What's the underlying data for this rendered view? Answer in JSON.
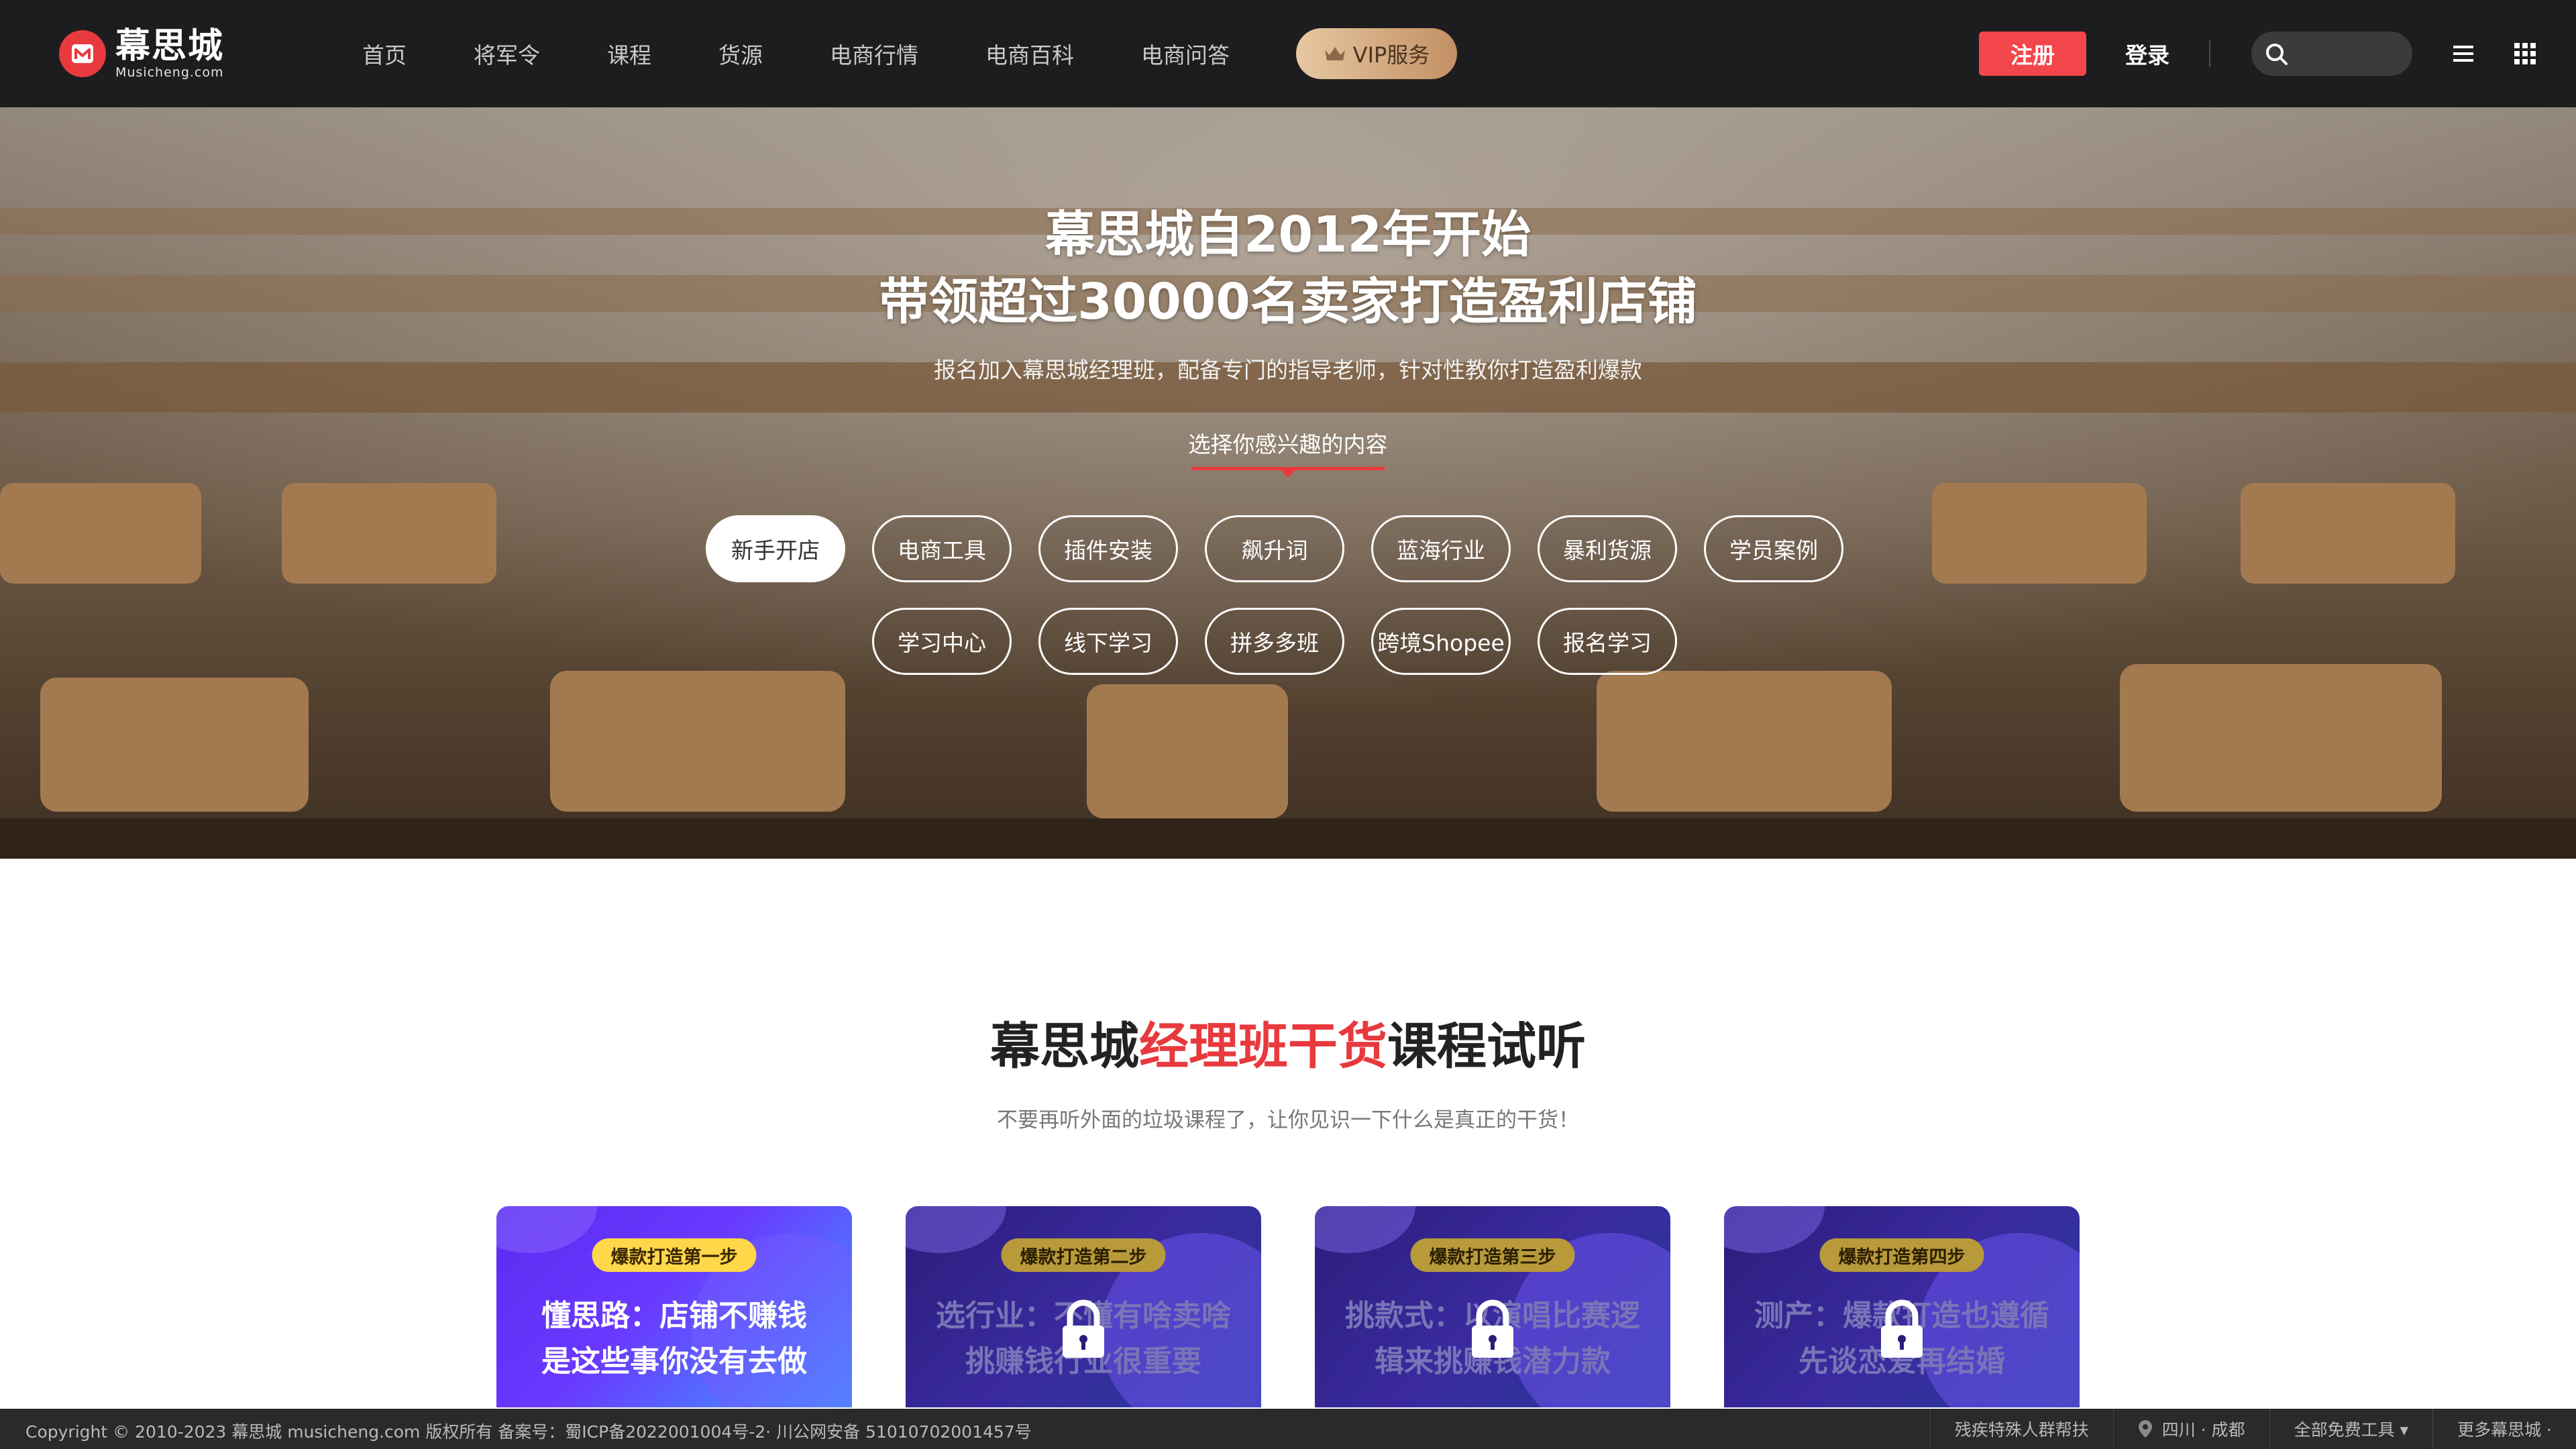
{
  "header": {
    "logo_cn": "幕思城",
    "logo_en": "Musicheng.com",
    "nav": [
      "首页",
      "将军令",
      "课程",
      "货源",
      "电商行情",
      "电商百科",
      "电商问答"
    ],
    "vip_label": "VIP服务",
    "register_label": "注册",
    "login_label": "登录"
  },
  "hero": {
    "title_line1": "幕思城自2012年开始",
    "title_line2": "带领超过30000名卖家打造盈利店铺",
    "subtitle": "报名加入幕思城经理班，配备专门的指导老师，针对性教你打造盈利爆款",
    "pick_label": "选择你感兴趣的内容",
    "tags_row1": [
      "新手开店",
      "电商工具",
      "插件安装",
      "飙升词",
      "蓝海行业",
      "暴利货源",
      "学员案例"
    ],
    "tags_row2": [
      "学习中心",
      "线下学习",
      "拼多多班",
      "跨境Shopee",
      "报名学习"
    ],
    "active_tag": "新手开店"
  },
  "section": {
    "title_prefix": "幕思城",
    "title_highlight": "经理班干货",
    "title_suffix": "课程试听",
    "subtitle": "不要再听外面的垃圾课程了，让你见识一下什么是真正的干货！"
  },
  "cards": [
    {
      "step": "爆款打造第一步",
      "line1": "懂思路：店铺不赚钱",
      "line2": "是这些事你没有去做",
      "locked": false
    },
    {
      "step": "爆款打造第二步",
      "line1": "选行业：不懂有啥卖啥",
      "line2": "挑赚钱行业很重要",
      "locked": true
    },
    {
      "step": "爆款打造第三步",
      "line1": "挑款式：以演唱比赛逻",
      "line2": "辑来挑赚钱潜力款",
      "locked": true
    },
    {
      "step": "爆款打造第四步",
      "line1": "测产：爆款打造也遵循",
      "line2": "先谈恋爱再结婚",
      "locked": true
    }
  ],
  "footer": {
    "copyright": "Copyright © 2010-2023 幕思城 musicheng.com 版权所有 备案号：蜀ICP备2022001004号-2· 川公网安备 51010702001457号",
    "links": [
      "残疾特殊人群帮扶",
      "四川 · 成都",
      "全部免费工具 ▾",
      "更多幕思城 ·"
    ]
  },
  "colors": {
    "brand_red": "#e8393e",
    "header_bg": "#1d1d1f",
    "vip_gold": "#d4a77a",
    "card_purple": "#5b2bf0"
  }
}
